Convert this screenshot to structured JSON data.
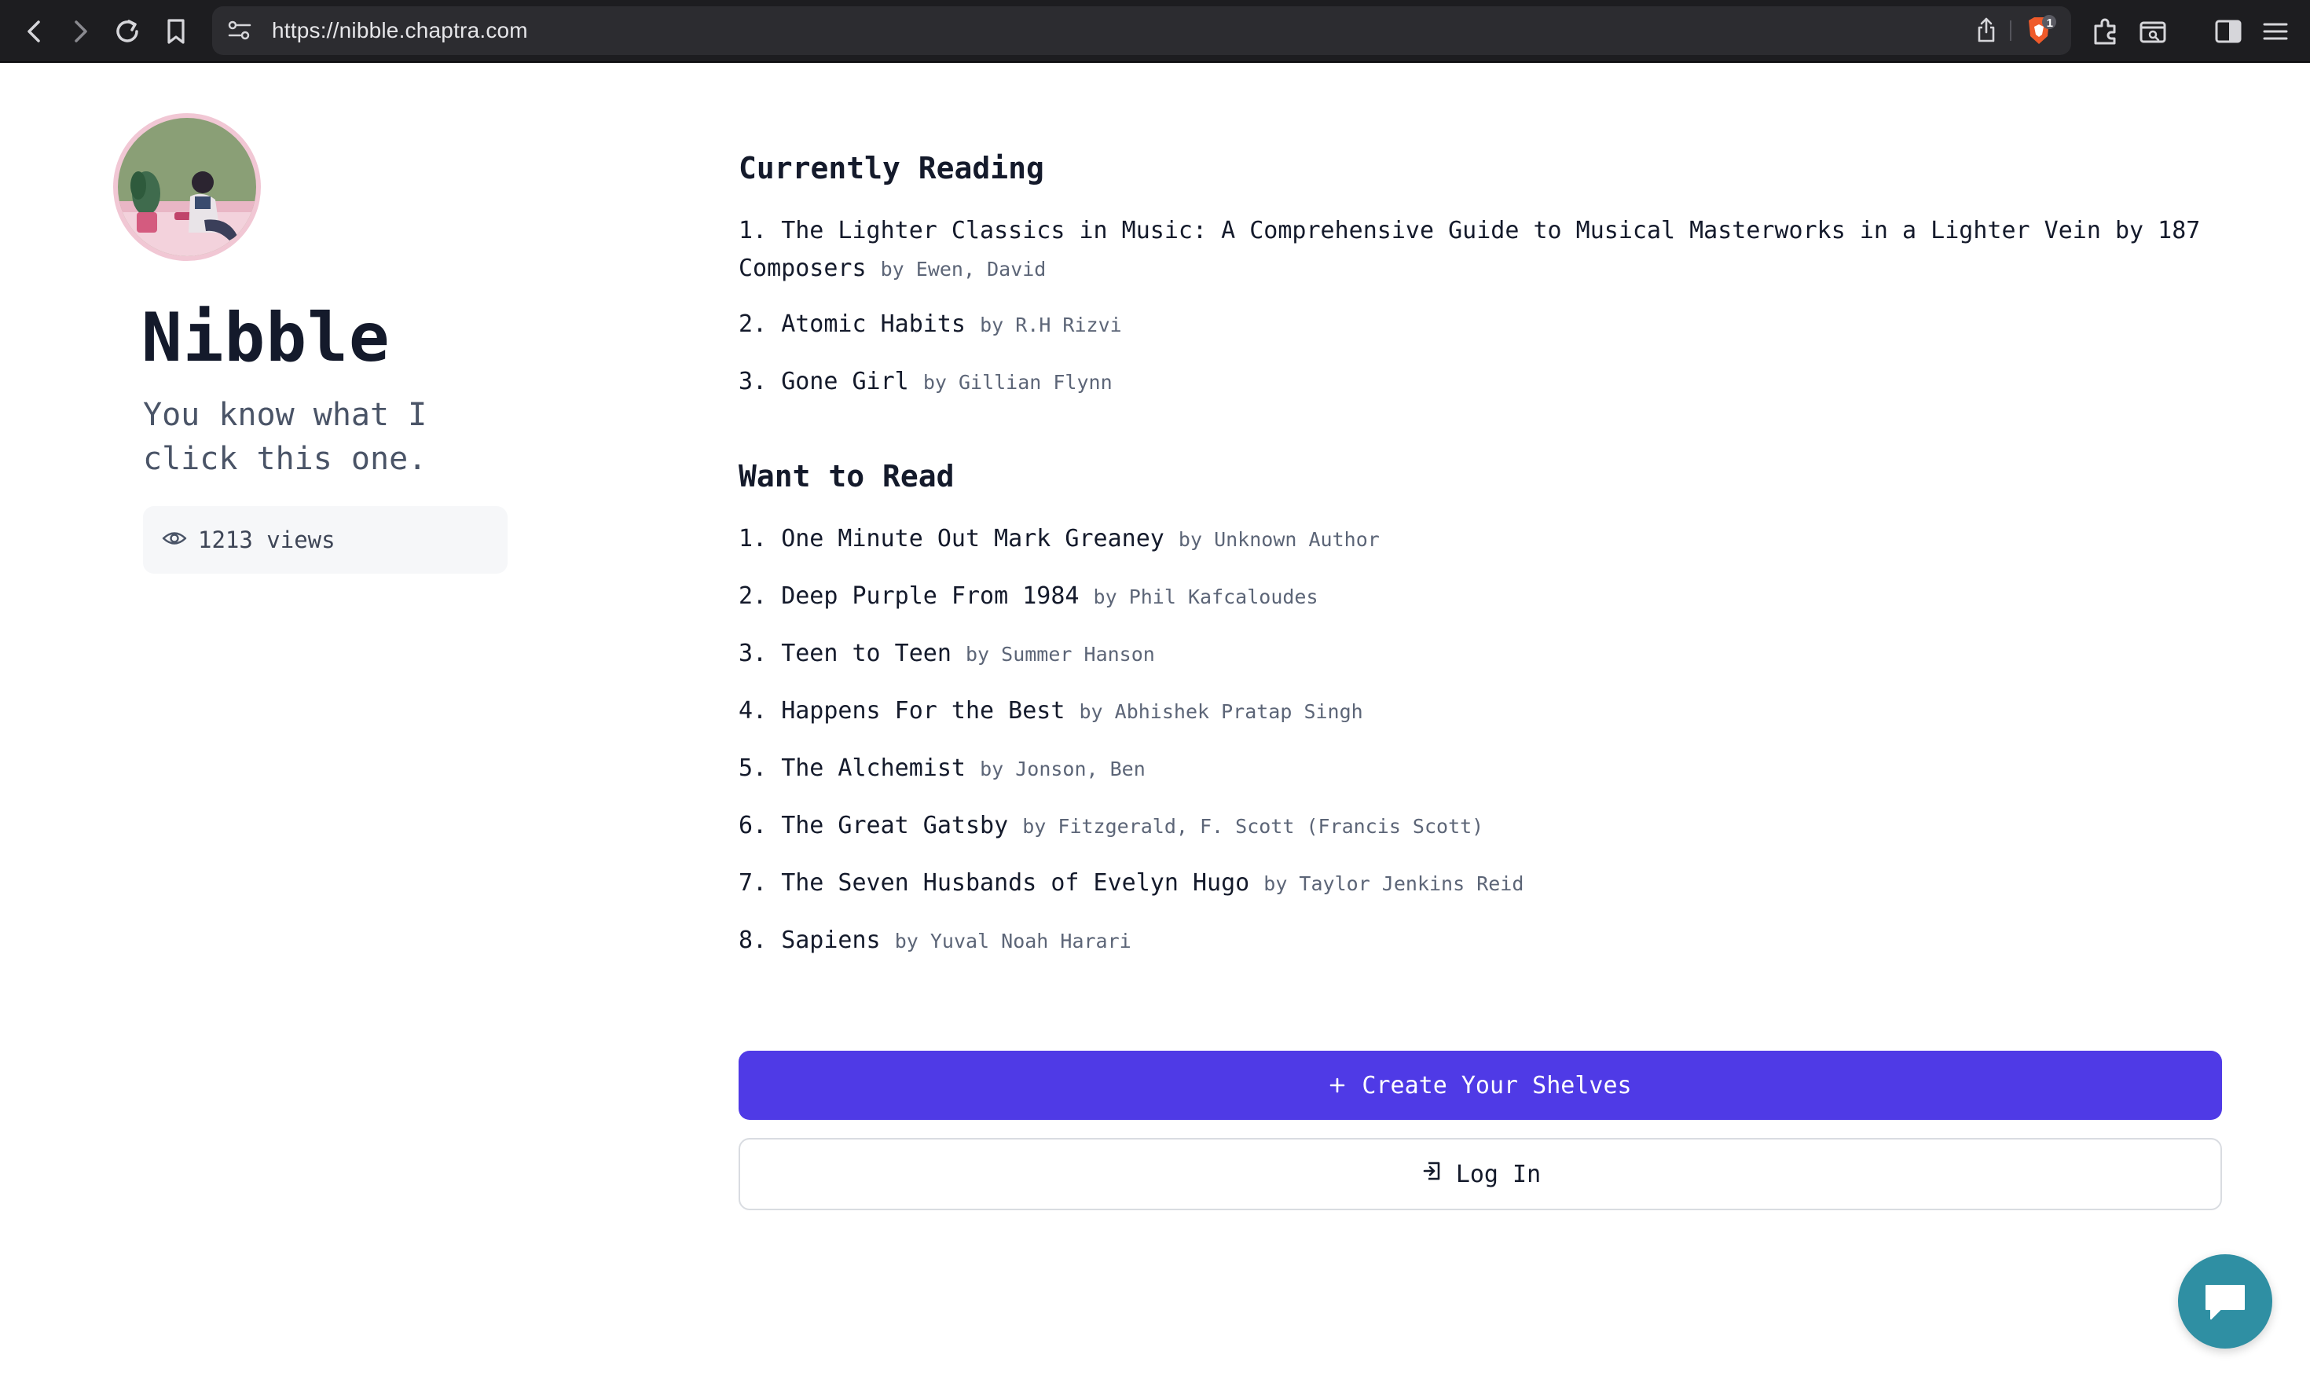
{
  "browser": {
    "url": "https://nibble.chaptra.com",
    "brave_badge_count": "1",
    "icons": [
      "back-icon",
      "forward-icon",
      "reload-icon",
      "bookmark-icon",
      "site-settings-icon",
      "share-icon",
      "brave-shields-icon",
      "extensions-icon",
      "wallet-icon",
      "sidebar-icon",
      "menu-icon"
    ]
  },
  "profile": {
    "name": "Nibble",
    "bio": "You know what I click this one.",
    "views": "1213 views"
  },
  "currently_reading": {
    "title": "Currently Reading",
    "books": [
      {
        "num": "1.",
        "title": "The Lighter Classics in Music: A Comprehensive Guide to Musical Masterworks in a Lighter Vein by 187 Composers",
        "author": "by Ewen, David"
      },
      {
        "num": "2.",
        "title": "Atomic Habits",
        "author": "by R.H Rizvi"
      },
      {
        "num": "3.",
        "title": "Gone Girl",
        "author": "by Gillian Flynn"
      }
    ]
  },
  "want_to_read": {
    "title": "Want to Read",
    "books": [
      {
        "num": "1.",
        "title": "One Minute Out Mark Greaney",
        "author": "by Unknown Author"
      },
      {
        "num": "2.",
        "title": "Deep Purple From 1984",
        "author": "by Phil Kafcaloudes"
      },
      {
        "num": "3.",
        "title": "Teen to Teen",
        "author": "by Summer Hanson"
      },
      {
        "num": "4.",
        "title": "Happens For the Best",
        "author": "by Abhishek Pratap Singh"
      },
      {
        "num": "5.",
        "title": "The Alchemist",
        "author": "by Jonson, Ben"
      },
      {
        "num": "6.",
        "title": "The Great Gatsby",
        "author": "by Fitzgerald, F. Scott (Francis Scott)"
      },
      {
        "num": "7.",
        "title": "The Seven Husbands of Evelyn Hugo",
        "author": "by Taylor Jenkins Reid"
      },
      {
        "num": "8.",
        "title": "Sapiens",
        "author": "by Yuval Noah Harari"
      }
    ]
  },
  "actions": {
    "create_label": "Create Your Shelves",
    "login_label": "Log In"
  },
  "colors": {
    "primary": "#4f3ae6",
    "chat_fab": "#2f8fa3",
    "text": "#141a2b",
    "muted": "#5c6577"
  }
}
